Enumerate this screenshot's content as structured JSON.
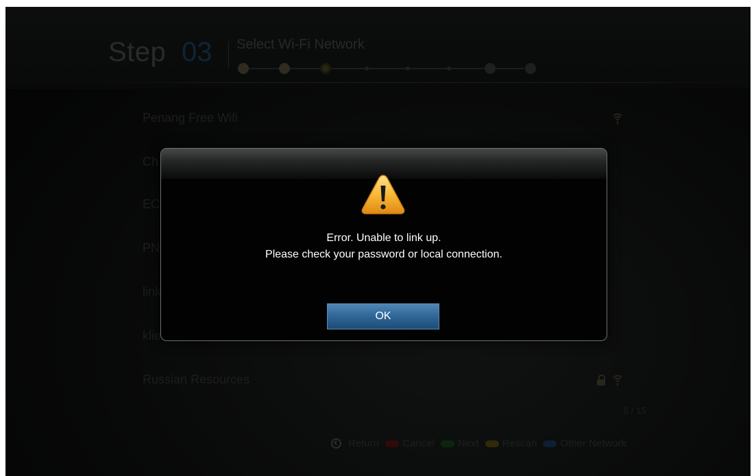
{
  "header": {
    "step_word": "Step",
    "step_number": "03",
    "title": "Select Wi-Fi Network",
    "progress": {
      "total_steps": 8,
      "current_step": 3
    }
  },
  "networks": [
    {
      "name": "Penang Free Wifi",
      "locked": false,
      "icon": "wifi-icon"
    },
    {
      "name": "Ch",
      "locked": false,
      "icon": "wifi-icon"
    },
    {
      "name": "EC",
      "locked": false,
      "icon": "wifi-icon"
    },
    {
      "name": "PN",
      "locked": false,
      "icon": "wifi-icon"
    },
    {
      "name": "link",
      "locked": false,
      "icon": "wifi-icon"
    },
    {
      "name": "klie",
      "locked": false,
      "icon": "wifi-icon"
    },
    {
      "name": "Russian Resources",
      "locked": true,
      "icon": "wifi-icon"
    }
  ],
  "pagination": "5 / 15",
  "legend": {
    "return": "Return",
    "items": [
      {
        "label": "Cancel",
        "color": "#8a1818"
      },
      {
        "label": "Next",
        "color": "#1c6b1c"
      },
      {
        "label": "Rescan",
        "color": "#8a7312"
      },
      {
        "label": "Other Network",
        "color": "#1e5596"
      }
    ]
  },
  "dialog": {
    "icon": "warning-icon",
    "message_line1": "Error. Unable to link up.",
    "message_line2": "Please check your password or local connection.",
    "ok_label": "OK"
  },
  "colors": {
    "accent_blue": "#2f6697",
    "warning_yellow": "#f2b02f"
  }
}
